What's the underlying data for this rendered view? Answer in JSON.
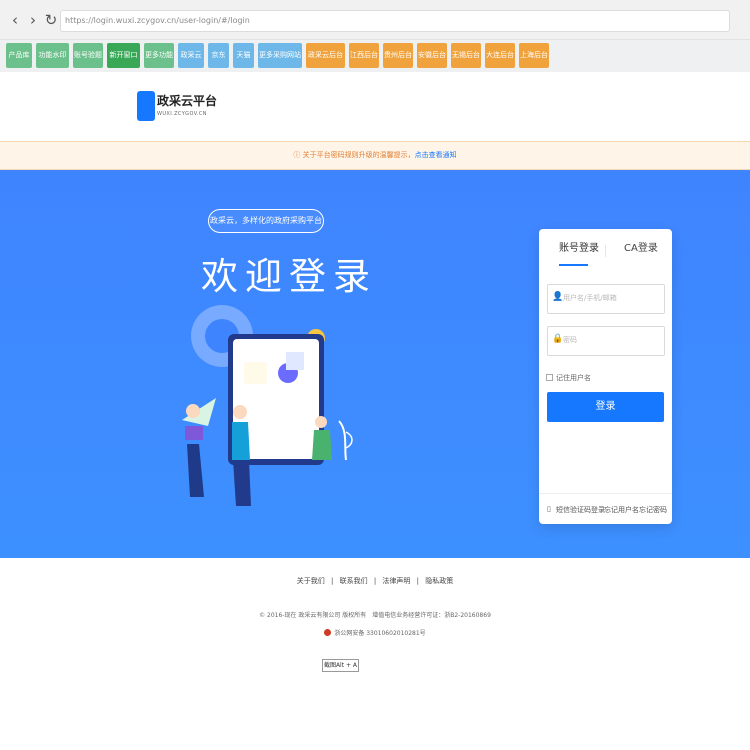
{
  "browser": {
    "url": "https://login.wuxi.zcygov.cn/user-login/#/login"
  },
  "bookmarks": [
    {
      "label": "产品库",
      "color": "#6cc08b"
    },
    {
      "label": "功能水印",
      "color": "#6cc08b"
    },
    {
      "label": "账号验题",
      "color": "#6cc08b"
    },
    {
      "label": "新开窗口",
      "color": "#38a857"
    },
    {
      "label": "更多功能",
      "color": "#6cc08b"
    },
    {
      "label": "政采云",
      "color": "#6db8e9"
    },
    {
      "label": "京东",
      "color": "#6db8e9"
    },
    {
      "label": "天猫",
      "color": "#6db8e9"
    },
    {
      "label": "更多采购网站",
      "color": "#6db8e9"
    },
    {
      "label": "政采云后台",
      "color": "#f0a33c"
    },
    {
      "label": "江西后台",
      "color": "#f0a33c"
    },
    {
      "label": "贵州后台",
      "color": "#f0a33c"
    },
    {
      "label": "安徽后台",
      "color": "#f0a33c"
    },
    {
      "label": "无锡后台",
      "color": "#f0a33c"
    },
    {
      "label": "大连后台",
      "color": "#f0a33c"
    },
    {
      "label": "上海后台",
      "color": "#f0a33c"
    }
  ],
  "brand": {
    "title": "政采云平台",
    "subtitle": "WUXI.ZCYGOV.CN"
  },
  "notice": {
    "text": "关于平台密码规则升级的温馨提示，",
    "link": "点击查看通知"
  },
  "hero": {
    "tagline": "政采云，多样化的政府采购平台",
    "welcome": "欢迎登录"
  },
  "login": {
    "tabs": [
      "账号登录",
      "CA登录"
    ],
    "username_placeholder": "用户名/手机/邮箱",
    "password_placeholder": "密码",
    "remember": "记住用户名",
    "button": "登录",
    "sms": "短信验证码登录",
    "forgot_user": "忘记用户名",
    "forgot_password": "忘记密码"
  },
  "footer": {
    "links": [
      "关于我们",
      "联系我们",
      "法律声明",
      "隐私政策"
    ],
    "copyright": "© 2016-现在 政采云有限公司 版权所有　增值电信业务经营许可证：浙B2-20160869",
    "police": "浙公网安备 33010602010281号"
  },
  "screenshot_hint": "截图Alt + A",
  "icons": [
    "user-icon",
    "lock-icon",
    "phone-icon"
  ],
  "accent": "#1677ff"
}
